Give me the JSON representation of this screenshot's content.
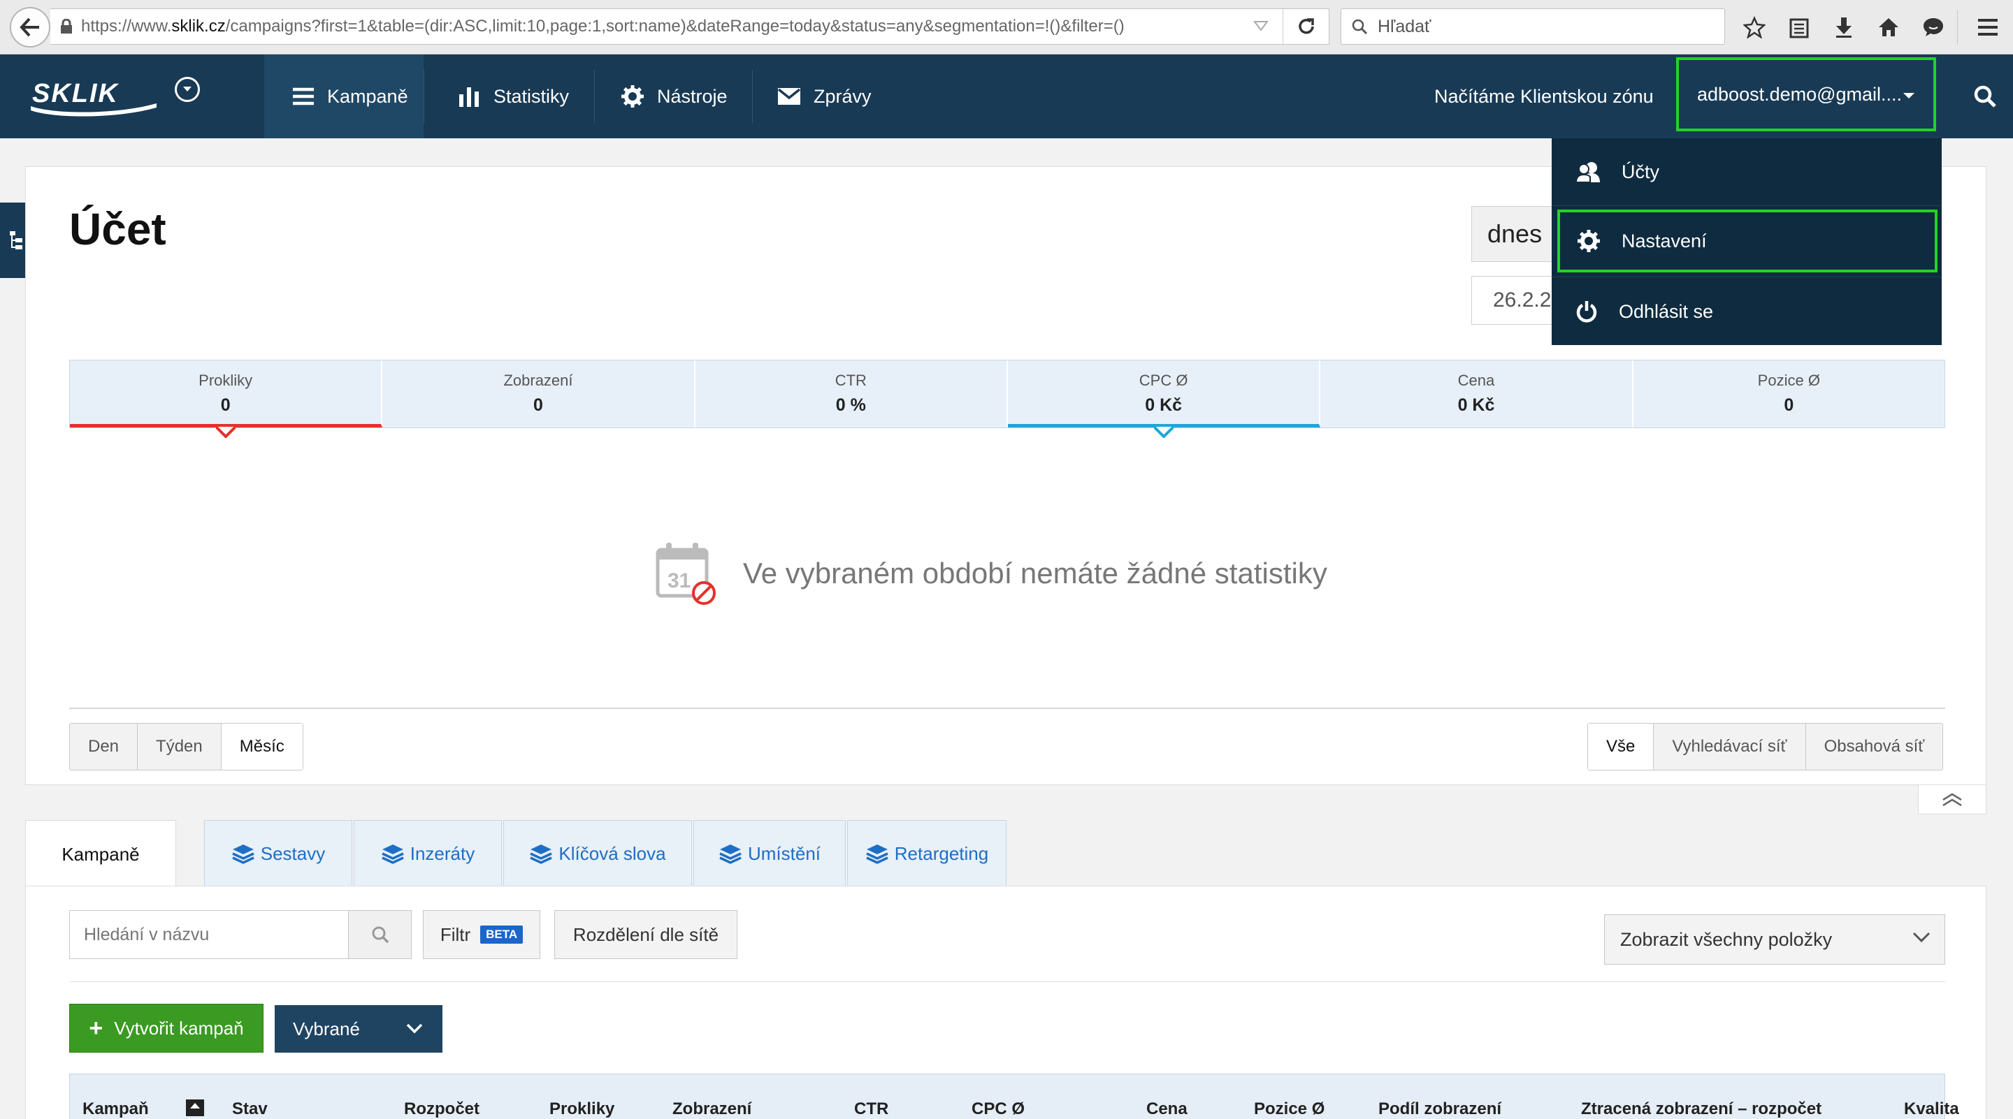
{
  "browser": {
    "url_prefix": "https://www.",
    "url_host": "sklik.cz",
    "url_rest": "/campaigns?first=1&table=(dir:ASC,limit:10,page:1,sort:name)&dateRange=today&status=any&segmentation=!()&filter=()",
    "search_placeholder": "Hľadať"
  },
  "header": {
    "logo_text": "SKLIK",
    "nav": [
      {
        "label": "Kampaně",
        "icon": "list-icon",
        "active": true
      },
      {
        "label": "Statistiky",
        "icon": "bar-chart-icon"
      },
      {
        "label": "Nástroje",
        "icon": "gear-icon"
      },
      {
        "label": "Zprávy",
        "icon": "envelope-icon"
      }
    ],
    "client_zone": "Načítáme Klientskou zónu",
    "account": "adboost.demo@gmail...."
  },
  "account_menu": {
    "items": [
      {
        "label": "Účty",
        "icon": "users-icon"
      },
      {
        "label": "Nastavení",
        "icon": "gear-icon",
        "highlighted": true
      },
      {
        "label": "Odhlásit se",
        "icon": "power-icon"
      }
    ]
  },
  "account_panel": {
    "title": "Účet",
    "date_range": "dnes",
    "date_value": "26.2.2",
    "stats": [
      {
        "label": "Prokliky",
        "value": "0",
        "marker": "red"
      },
      {
        "label": "Zobrazení",
        "value": "0"
      },
      {
        "label": "CTR",
        "value": "0 %"
      },
      {
        "label": "CPC Ø",
        "value": "0 Kč",
        "marker": "blue"
      },
      {
        "label": "Cena",
        "value": "0 Kč"
      },
      {
        "label": "Pozice Ø",
        "value": "0"
      }
    ],
    "empty_icon_day": "31",
    "empty_message": "Ve vybraném období nemáte žádné statistiky",
    "granularity": [
      "Den",
      "Týden",
      "Měsíc"
    ],
    "granularity_selected": "Měsíc",
    "network": [
      "Vše",
      "Vyhledávací síť",
      "Obsahová síť"
    ],
    "network_selected": "Vše"
  },
  "tabs": [
    {
      "label": "Kampaně",
      "active": true
    },
    {
      "label": "Sestavy"
    },
    {
      "label": "Inzeráty"
    },
    {
      "label": "Klíčová slova"
    },
    {
      "label": "Umístění"
    },
    {
      "label": "Retargeting"
    }
  ],
  "toolbar": {
    "search_placeholder": "Hledání v názvu",
    "filter_label": "Filtr",
    "filter_badge": "BETA",
    "split_label": "Rozdělení dle sítě",
    "show_all": "Zobrazit všechny položky",
    "create_label": "Vytvořit kampaň",
    "selected_label": "Vybrané"
  },
  "table": {
    "columns": [
      "Kampaň",
      "Stav",
      "Rozpočet",
      "Prokliky",
      "Zobrazení",
      "CTR",
      "CPC Ø",
      "Cena",
      "Pozice Ø",
      "Podíl zobrazení",
      "Ztracená zobrazení – rozpočet",
      "Kvalita"
    ]
  },
  "colors": {
    "nav_bg": "#183a55",
    "menu_bg": "#0f2b3f",
    "highlight": "#24d224",
    "primary_green": "#3a9a22",
    "link_blue": "#1e6ec5"
  }
}
